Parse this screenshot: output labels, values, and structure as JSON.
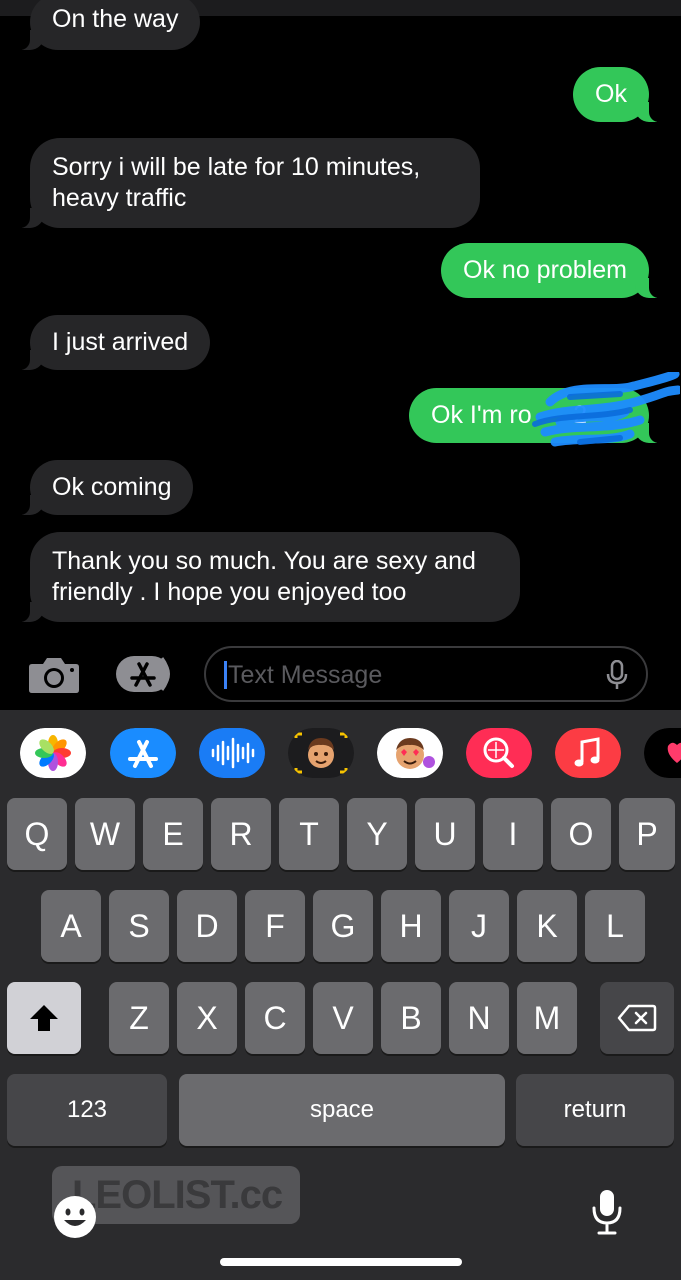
{
  "conversation": {
    "messages": [
      {
        "direction": "incoming",
        "text": "On the way"
      },
      {
        "direction": "outgoing",
        "text": "Ok"
      },
      {
        "direction": "incoming",
        "text": "Sorry i will be late for 10 minutes,\nheavy traffic"
      },
      {
        "direction": "outgoing",
        "text": "Ok no problem"
      },
      {
        "direction": "incoming",
        "text": "I just arrived"
      },
      {
        "direction": "outgoing",
        "text": "Ok I'm ro      2",
        "partially_obscured": true
      },
      {
        "direction": "incoming",
        "text": "Ok coming"
      },
      {
        "direction": "incoming",
        "text": "Thank you so much. You are sexy and\nfriendly . I hope you enjoyed too"
      }
    ]
  },
  "input_bar": {
    "camera_icon": "camera-icon",
    "apps_icon": "app-store-icon",
    "placeholder": "Text Message",
    "mic_icon": "microphone-icon"
  },
  "app_drawer": {
    "apps": [
      "photos-icon",
      "app-store-icon",
      "audio-message-icon",
      "memoji-icon",
      "memoji-stickers-icon",
      "search-images-icon",
      "music-icon",
      "digital-touch-icon"
    ]
  },
  "keyboard": {
    "row1": [
      "Q",
      "W",
      "E",
      "R",
      "T",
      "Y",
      "U",
      "I",
      "O",
      "P"
    ],
    "row2": [
      "A",
      "S",
      "D",
      "F",
      "G",
      "H",
      "J",
      "K",
      "L"
    ],
    "row3": [
      "Z",
      "X",
      "C",
      "V",
      "B",
      "N",
      "M"
    ],
    "numbers_label": "123",
    "space_label": "space",
    "return_label": "return",
    "shift_icon": "shift-icon",
    "delete_icon": "delete-icon",
    "emoji_icon": "emoji-icon",
    "dictation_icon": "microphone-icon"
  },
  "watermark": "LEOLIST.cc",
  "colors": {
    "outgoing_bubble": "#33c759",
    "incoming_bubble": "#262628",
    "keyboard_bg": "#2b2b2d",
    "key_bg": "#6b6b6e",
    "caret": "#3b82f6"
  }
}
